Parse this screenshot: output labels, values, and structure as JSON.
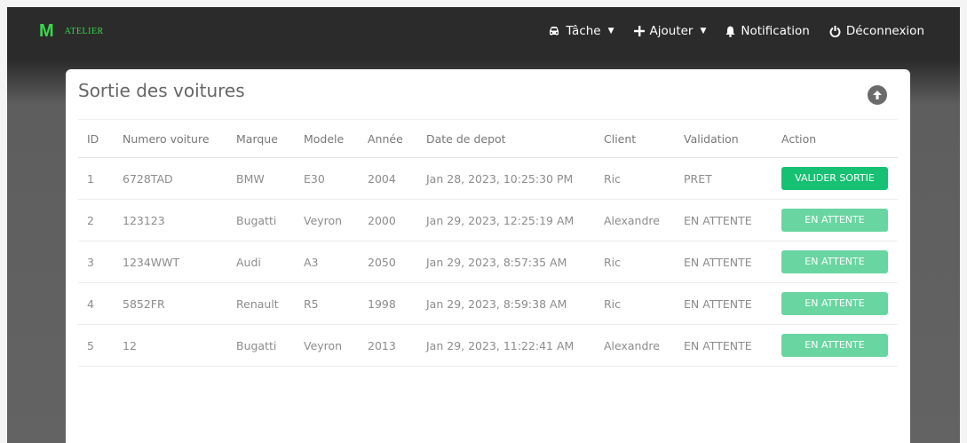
{
  "brand": {
    "logo": "M",
    "name": "ATELIER"
  },
  "nav": {
    "tache": "Tâche",
    "ajouter": "Ajouter",
    "notification": "Notification",
    "deconnexion": "Déconnexion"
  },
  "page": {
    "title": "Sortie des voitures"
  },
  "table": {
    "headers": [
      "ID",
      "Numero voiture",
      "Marque",
      "Modele",
      "Année",
      "Date de depot",
      "Client",
      "Validation",
      "Action"
    ],
    "rows": [
      {
        "id": "1",
        "numero": "6728TAD",
        "marque": "BMW",
        "modele": "E30",
        "annee": "2004",
        "date": "Jan 28, 2023, 10:25:30 PM",
        "client": "Ric",
        "validation": "PRET",
        "action": "VALIDER SORTIE",
        "action_state": "active"
      },
      {
        "id": "2",
        "numero": "123123",
        "marque": "Bugatti",
        "modele": "Veyron",
        "annee": "2000",
        "date": "Jan 29, 2023, 12:25:19 AM",
        "client": "Alexandre",
        "validation": "EN ATTENTE",
        "action": "EN ATTENTE",
        "action_state": "waiting"
      },
      {
        "id": "3",
        "numero": "1234WWT",
        "marque": "Audi",
        "modele": "A3",
        "annee": "2050",
        "date": "Jan 29, 2023, 8:57:35 AM",
        "client": "Ric",
        "validation": "EN ATTENTE",
        "action": "EN ATTENTE",
        "action_state": "waiting"
      },
      {
        "id": "4",
        "numero": "5852FR",
        "marque": "Renault",
        "modele": "R5",
        "annee": "1998",
        "date": "Jan 29, 2023, 8:59:38 AM",
        "client": "Ric",
        "validation": "EN ATTENTE",
        "action": "EN ATTENTE",
        "action_state": "waiting"
      },
      {
        "id": "5",
        "numero": "12",
        "marque": "Bugatti",
        "modele": "Veyron",
        "annee": "2013",
        "date": "Jan 29, 2023, 11:22:41 AM",
        "client": "Alexandre",
        "validation": "EN ATTENTE",
        "action": "EN ATTENTE",
        "action_state": "waiting"
      }
    ]
  },
  "colors": {
    "accent_green": "#16c173",
    "waiting_green": "#69d5a1",
    "brand_green": "#39d84a"
  },
  "icons": {
    "tache": "car-icon",
    "ajouter": "plus-icon",
    "notification": "bell-icon",
    "deconnexion": "power-icon",
    "scroll_up": "arrow-up-circle-icon"
  }
}
